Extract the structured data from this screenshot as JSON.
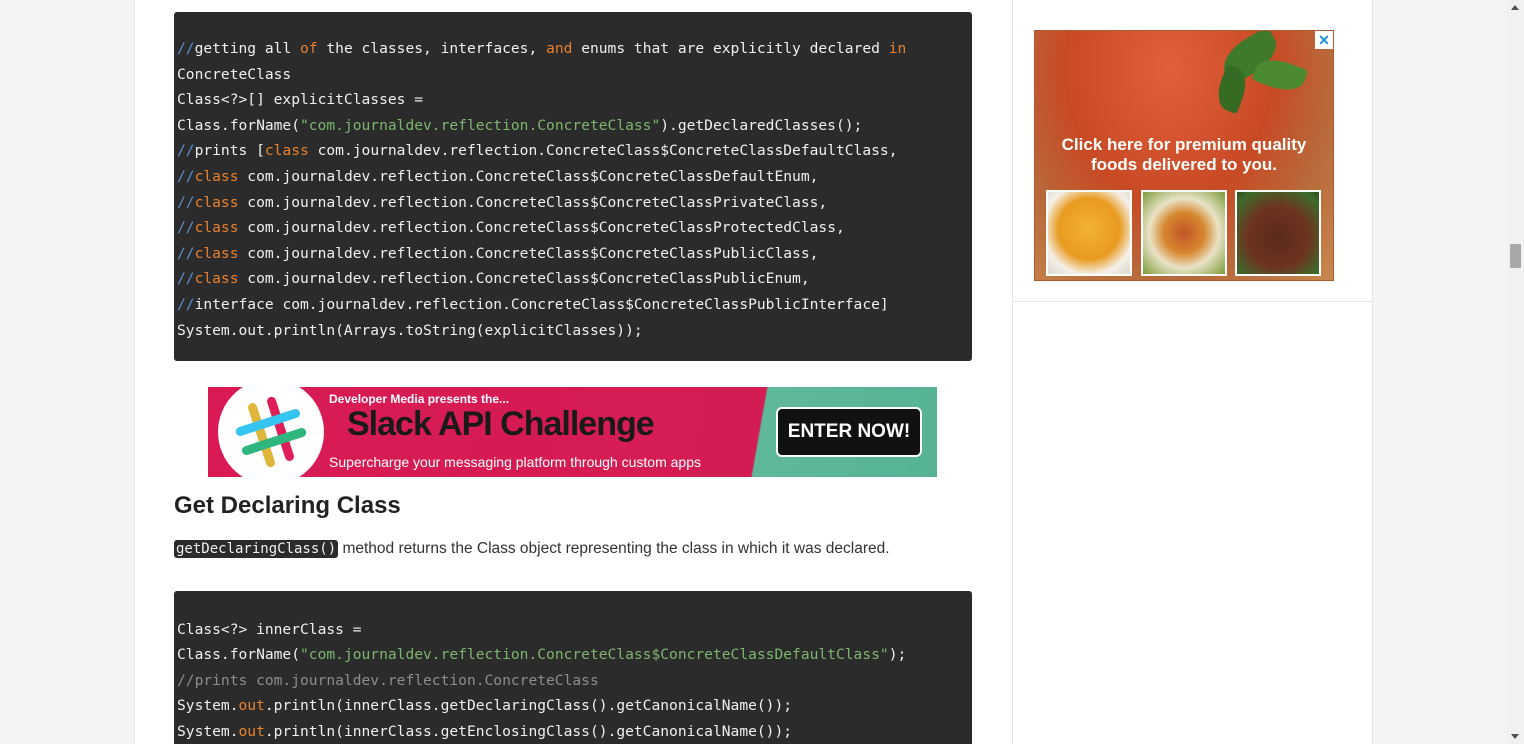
{
  "code_block_1": {
    "lines": [
      [
        [
          "c-com",
          "//"
        ],
        [
          "",
          "getting all "
        ],
        [
          "c-kw",
          "of"
        ],
        [
          "",
          " the classes, interfaces, "
        ],
        [
          "c-kw",
          "and"
        ],
        [
          "",
          " enums that are explicitly declared "
        ],
        [
          "c-kw",
          "in"
        ]
      ],
      [
        [
          "",
          "ConcreteClass"
        ]
      ],
      [
        [
          "",
          "Class<?>[] explicitClasses ="
        ]
      ],
      [
        [
          "",
          "Class.forName("
        ],
        [
          "c-str",
          "\"com.journaldev.reflection.ConcreteClass\""
        ],
        [
          "",
          ").getDeclaredClasses();"
        ]
      ],
      [
        [
          "c-com",
          "//"
        ],
        [
          "",
          "prints ["
        ],
        [
          "c-kw",
          "class"
        ],
        [
          "",
          " com.journaldev.reflection.ConcreteClass$ConcreteClassDefaultClass,"
        ]
      ],
      [
        [
          "c-com",
          "//"
        ],
        [
          "c-kw",
          "class"
        ],
        [
          "",
          " com.journaldev.reflection.ConcreteClass$ConcreteClassDefaultEnum,"
        ]
      ],
      [
        [
          "c-com",
          "//"
        ],
        [
          "c-kw",
          "class"
        ],
        [
          "",
          " com.journaldev.reflection.ConcreteClass$ConcreteClassPrivateClass,"
        ]
      ],
      [
        [
          "c-com",
          "//"
        ],
        [
          "c-kw",
          "class"
        ],
        [
          "",
          " com.journaldev.reflection.ConcreteClass$ConcreteClassProtectedClass,"
        ]
      ],
      [
        [
          "c-com",
          "//"
        ],
        [
          "c-kw",
          "class"
        ],
        [
          "",
          " com.journaldev.reflection.ConcreteClass$ConcreteClassPublicClass,"
        ]
      ],
      [
        [
          "c-com",
          "//"
        ],
        [
          "c-kw",
          "class"
        ],
        [
          "",
          " com.journaldev.reflection.ConcreteClass$ConcreteClassPublicEnum,"
        ]
      ],
      [
        [
          "c-com",
          "//"
        ],
        [
          "",
          "interface com.journaldev.reflection.ConcreteClass$ConcreteClassPublicInterface]"
        ]
      ],
      [
        [
          "",
          "System.out.println(Arrays.toString(explicitClasses));"
        ]
      ]
    ]
  },
  "slack_ad": {
    "pre_title": "Developer Media presents the...",
    "title": "Slack API Challenge",
    "subtitle": "Supercharge your messaging platform through custom apps",
    "button": "ENTER NOW!"
  },
  "section": {
    "heading": "Get Declaring Class",
    "inline_code": "getDeclaringClass()",
    "text": " method returns the Class object representing the class in which it was declared."
  },
  "code_block_2": {
    "lines": [
      [
        [
          "",
          ""
        ]
      ],
      [
        [
          "",
          "Class<?> innerClass ="
        ]
      ],
      [
        [
          "",
          "Class.forName("
        ],
        [
          "c-str",
          "\"com.journaldev.reflection.ConcreteClass$ConcreteClassDefaultClass\""
        ],
        [
          "",
          ");"
        ]
      ],
      [
        [
          "c-grey",
          "//prints com.journaldev.reflection.ConcreteClass"
        ]
      ],
      [
        [
          "",
          "System."
        ],
        [
          "c-kw",
          "out"
        ],
        [
          "",
          ".println(innerClass.getDeclaringClass().getCanonicalName());"
        ]
      ],
      [
        [
          "",
          "System."
        ],
        [
          "c-kw",
          "out"
        ],
        [
          "",
          ".println(innerClass.getEnclosingClass().getCanonicalName());"
        ]
      ]
    ]
  },
  "food_ad": {
    "text_line1": "Click here for premium quality",
    "text_line2": "foods delivered to you.",
    "close": "✕"
  },
  "colors": {
    "code_bg": "#2b2b2b",
    "keyword": "#e8812d",
    "string": "#7cb66d",
    "comment_slash": "#5b8fcf",
    "slack_pink": "#d91a55",
    "slack_green": "#5fb89a"
  }
}
